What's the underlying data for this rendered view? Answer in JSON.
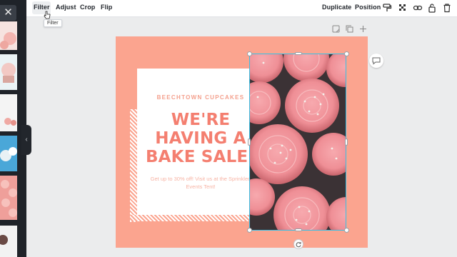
{
  "sidebar": {
    "close_icon": "close-icon",
    "collapse_icon": "chevron-left-icon",
    "thumbnails": [
      "cupcake thumbnail 1",
      "cupcake thumbnail 2",
      "cupcake thumbnail 3",
      "cupcake thumbnail 4",
      "cupcake thumbnail 5",
      "cupcake thumbnail 6"
    ]
  },
  "toolbar": {
    "left_items": [
      "Filter",
      "Adjust",
      "Crop",
      "Flip"
    ],
    "right_items": [
      "Duplicate",
      "Position"
    ],
    "icons": [
      "paint-roller-icon",
      "transparency-icon",
      "link-icon",
      "lock-icon",
      "trash-icon"
    ],
    "tooltip": "Filter"
  },
  "page_actions": [
    "notes-icon",
    "copy-page-icon",
    "add-page-icon"
  ],
  "design": {
    "brand": "BEECHTOWN CUPCAKES",
    "headline_lines": [
      "WE'RE",
      "HAVING A",
      "BAKE SALE!"
    ],
    "subtext": "Get up to 30% off! Visit us at the Sprinkled Events Tent!",
    "photo": "pink frosted cupcakes with sprinkles"
  },
  "colors": {
    "background": "#fba48f",
    "headline": "#f47f70",
    "selection": "#35c1e6",
    "sidebar": "#1f2329"
  }
}
